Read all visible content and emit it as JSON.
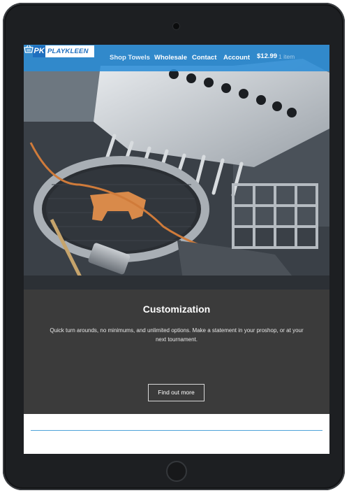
{
  "nav": {
    "logo_mark": "PK",
    "logo_text": "PLAYKLEEN",
    "links": [
      {
        "label": "Shop Towels"
      },
      {
        "label": "Wholesale"
      },
      {
        "label": "Contact"
      },
      {
        "label": "Account"
      }
    ],
    "cart_price": "$12.99",
    "cart_count": "1 item",
    "cart_icon": "basket-icon"
  },
  "hero": {
    "image": "embroidery-machine-photo"
  },
  "section": {
    "title": "Customization",
    "description": "Quick turn arounds, no minimums, and unlimited options. Make a statement in your proshop, or at your next tournament.",
    "button_label": "Find out more"
  },
  "colors": {
    "nav_blue": "#288cd7",
    "content_bg": "#3b3b3b",
    "divider": "#4fa3d9"
  }
}
